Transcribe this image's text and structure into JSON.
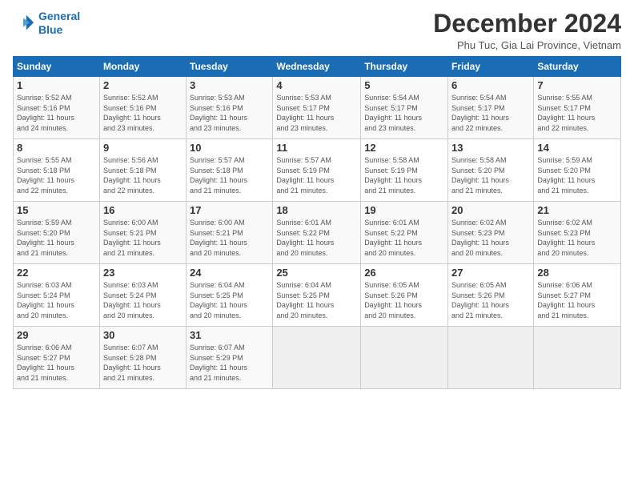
{
  "header": {
    "logo_line1": "General",
    "logo_line2": "Blue",
    "month_title": "December 2024",
    "location": "Phu Tuc, Gia Lai Province, Vietnam"
  },
  "days_of_week": [
    "Sunday",
    "Monday",
    "Tuesday",
    "Wednesday",
    "Thursday",
    "Friday",
    "Saturday"
  ],
  "weeks": [
    [
      {
        "day": "1",
        "info": "Sunrise: 5:52 AM\nSunset: 5:16 PM\nDaylight: 11 hours\nand 24 minutes."
      },
      {
        "day": "2",
        "info": "Sunrise: 5:52 AM\nSunset: 5:16 PM\nDaylight: 11 hours\nand 23 minutes."
      },
      {
        "day": "3",
        "info": "Sunrise: 5:53 AM\nSunset: 5:16 PM\nDaylight: 11 hours\nand 23 minutes."
      },
      {
        "day": "4",
        "info": "Sunrise: 5:53 AM\nSunset: 5:17 PM\nDaylight: 11 hours\nand 23 minutes."
      },
      {
        "day": "5",
        "info": "Sunrise: 5:54 AM\nSunset: 5:17 PM\nDaylight: 11 hours\nand 23 minutes."
      },
      {
        "day": "6",
        "info": "Sunrise: 5:54 AM\nSunset: 5:17 PM\nDaylight: 11 hours\nand 22 minutes."
      },
      {
        "day": "7",
        "info": "Sunrise: 5:55 AM\nSunset: 5:17 PM\nDaylight: 11 hours\nand 22 minutes."
      }
    ],
    [
      {
        "day": "8",
        "info": "Sunrise: 5:55 AM\nSunset: 5:18 PM\nDaylight: 11 hours\nand 22 minutes."
      },
      {
        "day": "9",
        "info": "Sunrise: 5:56 AM\nSunset: 5:18 PM\nDaylight: 11 hours\nand 22 minutes."
      },
      {
        "day": "10",
        "info": "Sunrise: 5:57 AM\nSunset: 5:18 PM\nDaylight: 11 hours\nand 21 minutes."
      },
      {
        "day": "11",
        "info": "Sunrise: 5:57 AM\nSunset: 5:19 PM\nDaylight: 11 hours\nand 21 minutes."
      },
      {
        "day": "12",
        "info": "Sunrise: 5:58 AM\nSunset: 5:19 PM\nDaylight: 11 hours\nand 21 minutes."
      },
      {
        "day": "13",
        "info": "Sunrise: 5:58 AM\nSunset: 5:20 PM\nDaylight: 11 hours\nand 21 minutes."
      },
      {
        "day": "14",
        "info": "Sunrise: 5:59 AM\nSunset: 5:20 PM\nDaylight: 11 hours\nand 21 minutes."
      }
    ],
    [
      {
        "day": "15",
        "info": "Sunrise: 5:59 AM\nSunset: 5:20 PM\nDaylight: 11 hours\nand 21 minutes."
      },
      {
        "day": "16",
        "info": "Sunrise: 6:00 AM\nSunset: 5:21 PM\nDaylight: 11 hours\nand 21 minutes."
      },
      {
        "day": "17",
        "info": "Sunrise: 6:00 AM\nSunset: 5:21 PM\nDaylight: 11 hours\nand 20 minutes."
      },
      {
        "day": "18",
        "info": "Sunrise: 6:01 AM\nSunset: 5:22 PM\nDaylight: 11 hours\nand 20 minutes."
      },
      {
        "day": "19",
        "info": "Sunrise: 6:01 AM\nSunset: 5:22 PM\nDaylight: 11 hours\nand 20 minutes."
      },
      {
        "day": "20",
        "info": "Sunrise: 6:02 AM\nSunset: 5:23 PM\nDaylight: 11 hours\nand 20 minutes."
      },
      {
        "day": "21",
        "info": "Sunrise: 6:02 AM\nSunset: 5:23 PM\nDaylight: 11 hours\nand 20 minutes."
      }
    ],
    [
      {
        "day": "22",
        "info": "Sunrise: 6:03 AM\nSunset: 5:24 PM\nDaylight: 11 hours\nand 20 minutes."
      },
      {
        "day": "23",
        "info": "Sunrise: 6:03 AM\nSunset: 5:24 PM\nDaylight: 11 hours\nand 20 minutes."
      },
      {
        "day": "24",
        "info": "Sunrise: 6:04 AM\nSunset: 5:25 PM\nDaylight: 11 hours\nand 20 minutes."
      },
      {
        "day": "25",
        "info": "Sunrise: 6:04 AM\nSunset: 5:25 PM\nDaylight: 11 hours\nand 20 minutes."
      },
      {
        "day": "26",
        "info": "Sunrise: 6:05 AM\nSunset: 5:26 PM\nDaylight: 11 hours\nand 20 minutes."
      },
      {
        "day": "27",
        "info": "Sunrise: 6:05 AM\nSunset: 5:26 PM\nDaylight: 11 hours\nand 21 minutes."
      },
      {
        "day": "28",
        "info": "Sunrise: 6:06 AM\nSunset: 5:27 PM\nDaylight: 11 hours\nand 21 minutes."
      }
    ],
    [
      {
        "day": "29",
        "info": "Sunrise: 6:06 AM\nSunset: 5:27 PM\nDaylight: 11 hours\nand 21 minutes."
      },
      {
        "day": "30",
        "info": "Sunrise: 6:07 AM\nSunset: 5:28 PM\nDaylight: 11 hours\nand 21 minutes."
      },
      {
        "day": "31",
        "info": "Sunrise: 6:07 AM\nSunset: 5:29 PM\nDaylight: 11 hours\nand 21 minutes."
      },
      {
        "day": "",
        "info": ""
      },
      {
        "day": "",
        "info": ""
      },
      {
        "day": "",
        "info": ""
      },
      {
        "day": "",
        "info": ""
      }
    ]
  ]
}
